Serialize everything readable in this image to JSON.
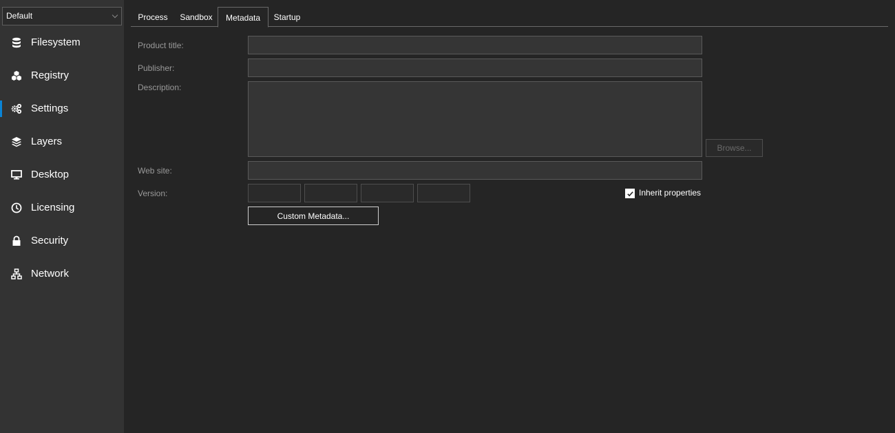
{
  "profile": {
    "selected": "Default"
  },
  "sidebar": {
    "items": [
      {
        "label": "Filesystem",
        "icon": "database-icon"
      },
      {
        "label": "Registry",
        "icon": "cubes-icon"
      },
      {
        "label": "Settings",
        "icon": "gears-icon",
        "active": true
      },
      {
        "label": "Layers",
        "icon": "layers-icon"
      },
      {
        "label": "Desktop",
        "icon": "monitor-icon"
      },
      {
        "label": "Licensing",
        "icon": "clock-icon"
      },
      {
        "label": "Security",
        "icon": "lock-icon"
      },
      {
        "label": "Network",
        "icon": "network-icon"
      }
    ],
    "accent_color": "#0a84d6"
  },
  "tabs": [
    {
      "label": "Process"
    },
    {
      "label": "Sandbox"
    },
    {
      "label": "Metadata",
      "active": true
    },
    {
      "label": "Startup"
    }
  ],
  "form": {
    "product_title_label": "Product title:",
    "product_title_value": "",
    "publisher_label": "Publisher:",
    "publisher_value": "",
    "description_label": "Description:",
    "description_value": "",
    "browse_label": "Browse...",
    "website_label": "Web site:",
    "website_value": "",
    "version_label": "Version:",
    "version_parts": [
      "",
      "",
      "",
      ""
    ],
    "inherit_label": "Inherit properties",
    "inherit_checked": true,
    "custom_metadata_label": "Custom Metadata..."
  }
}
